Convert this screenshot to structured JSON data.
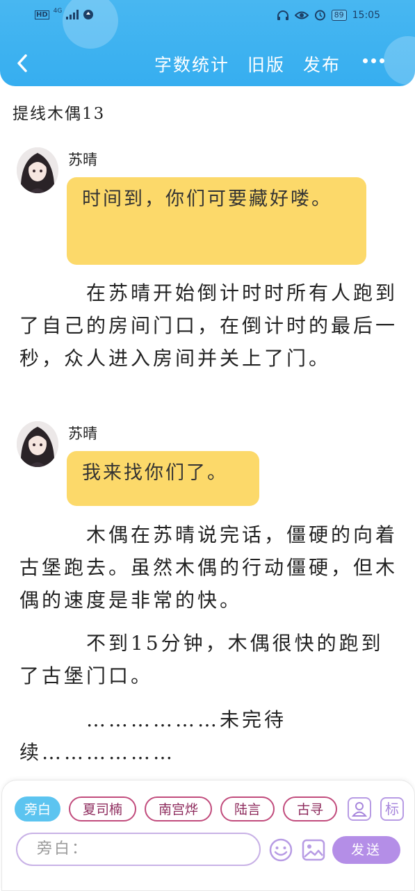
{
  "status_bar": {
    "left_icons": [
      "hd-icon",
      "4g-signal-icon",
      "data-saver-icon"
    ],
    "network_label": "4G",
    "hd_label": "HD",
    "battery": "89",
    "time": "15:05",
    "right_icons": [
      "headphones-icon",
      "eye-icon",
      "alarm-icon",
      "battery-icon"
    ]
  },
  "nav": {
    "back_icon": "chevron-left-icon",
    "word_count": "字数统计",
    "old_version": "旧版",
    "publish": "发布",
    "more_icon": "more-dots-icon"
  },
  "document": {
    "title": "提线木偶13",
    "messages": [
      {
        "speaker": "苏晴",
        "text": "时间到，你们可要藏好喽。"
      },
      {
        "speaker": "苏晴",
        "text": "我来找你们了。"
      }
    ],
    "paragraphs": [
      "在苏晴开始倒计时时所有人跑到了自己的房间门口，在倒计时的最后一秒，众人进入房间并关上了门。",
      "木偶在苏晴说完话，僵硬的向着古堡跑去。虽然木偶的行动僵硬，但木偶的速度是非常的快。",
      "不到15分钟，木偶很快的跑到了古堡门口。",
      "………………未完待续………………"
    ]
  },
  "composer": {
    "chips": [
      "旁白",
      "夏司楠",
      "南宫烨",
      "陆言",
      "古寻"
    ],
    "active_chip": "旁白",
    "role_icon": "person-card-icon",
    "tag_label": "标",
    "input_placeholder": "旁白：",
    "emoji_icon": "smiley-icon",
    "image_icon": "image-icon",
    "send_label": "发送"
  },
  "colors": {
    "header": "#3db2f0",
    "bubble": "#fcd96a",
    "accent": "#b48ee7",
    "chip_border": "#c14b7c",
    "active_chip": "#5cc4f0"
  }
}
